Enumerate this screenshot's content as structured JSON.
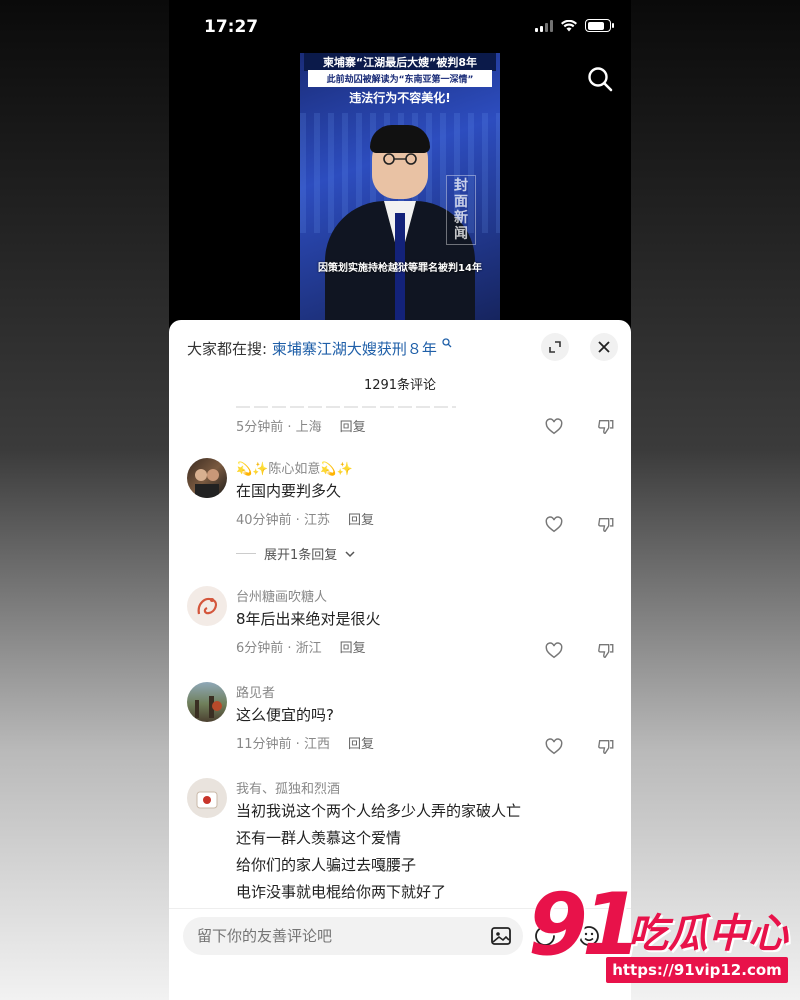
{
  "status_bar": {
    "time": "17:27"
  },
  "video": {
    "headline_1": "柬埔寨“江湖最后大嫂”被判8年",
    "headline_2": "此前劫囚被解读为“东南亚第一深情”",
    "headline_3": "违法行为不容美化!",
    "logo": "封面新闻",
    "subtitle": "因策划实施持枪越狱等罪名被判14年"
  },
  "sheet": {
    "hot_search_prefix": "大家都在搜:",
    "hot_search_keyword": "柬埔寨江湖大嫂获刑８年",
    "comment_count": "1291条评论"
  },
  "cut_comment": {
    "time_location": "5分钟前 · 上海",
    "reply": "回复"
  },
  "comments": [
    {
      "name": "💫✨陈心如意💫✨",
      "text": "在国内要判多久",
      "time_location": "40分钟前 · 江苏",
      "reply": "回复",
      "expand_replies": "展开1条回复"
    },
    {
      "name": "台州糖画吹糖人",
      "text": "8年后出来绝对是很火",
      "time_location": "6分钟前 · 浙江",
      "reply": "回复"
    },
    {
      "name": "路见者",
      "text": "这么便宜的吗?",
      "time_location": "11分钟前 · 江西",
      "reply": "回复"
    },
    {
      "name": "我有、孤独和烈酒",
      "text_lines": [
        "当初我说这个两个人给多少人弄的家破人亡",
        "还有一群人羡慕这个爱情",
        "给你们的家人骗过去嘎腰子",
        "电诈没事就电棍给你两下就好了"
      ]
    }
  ],
  "input": {
    "placeholder": "留下你的友善评论吧"
  },
  "watermark": {
    "number": "91",
    "text": "吃瓜中心",
    "url": "https://91vip12.com"
  },
  "colors": {
    "accent_keyword": "#1f5fa8",
    "watermark": "#e8124a"
  }
}
